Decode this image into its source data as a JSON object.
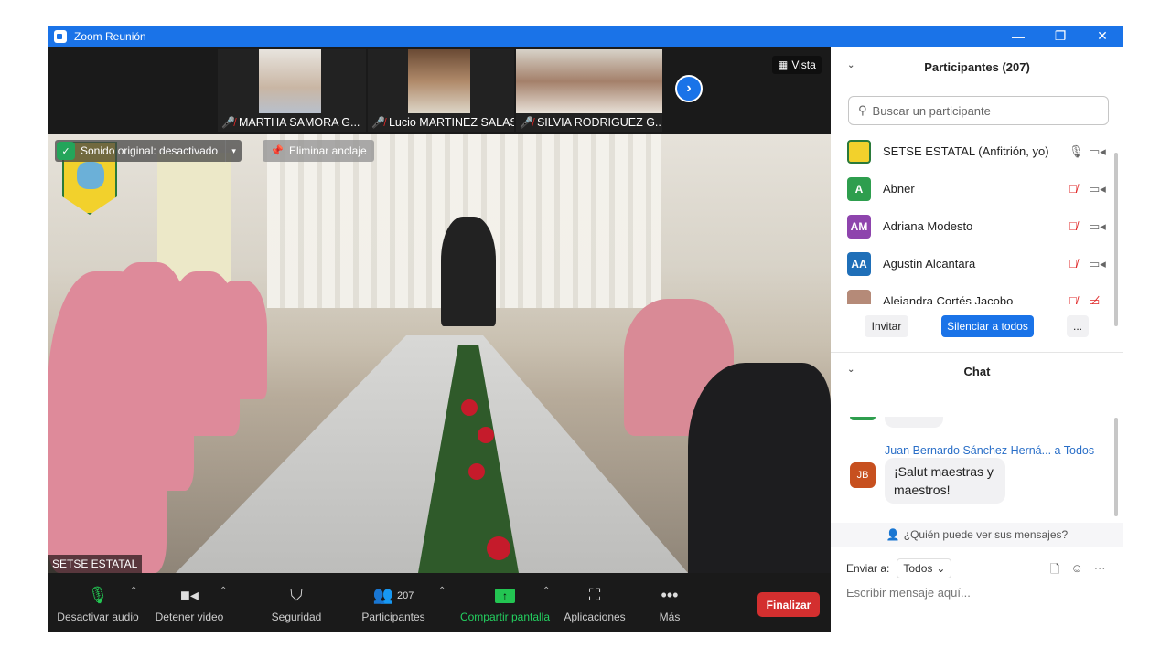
{
  "window": {
    "title": "Zoom Reunión",
    "controls": [
      "—",
      "❐",
      "✕"
    ]
  },
  "thumbnails": [
    {
      "name": "MARTHA SAMORA G...",
      "muted": true
    },
    {
      "name": "Lucio MARTINEZ SALAS",
      "muted": true
    },
    {
      "name": "SILVIA RODRIGUEZ G...",
      "muted": true
    }
  ],
  "view_label": "Vista",
  "main_video": {
    "audio_banner": "Sonido original: desactivado",
    "unpin_label": "Eliminar anclaje",
    "speaker_name": "SETSE ESTATAL"
  },
  "toolbar": {
    "mute_label": "Desactivar audio",
    "video_label": "Detener video",
    "security_label": "Seguridad",
    "participants_label": "Participantes",
    "participants_count": "207",
    "share_label": "Compartir pantalla",
    "apps_label": "Aplicaciones",
    "more_label": "Más",
    "end_label": "Finalizar"
  },
  "participants_panel": {
    "title": "Participantes (207)",
    "search_placeholder": "Buscar un participante",
    "rows": [
      {
        "name": "SETSE ESTATAL (Anfitrión, yo)",
        "initials": "",
        "color": "#f2d12c"
      },
      {
        "name": "Abner",
        "initials": "A",
        "color": "#2e9e4e"
      },
      {
        "name": "Adriana Modesto",
        "initials": "AM",
        "color": "#8e44ad"
      },
      {
        "name": "Agustin Alcantara",
        "initials": "AA",
        "color": "#1f6fb8"
      },
      {
        "name": "Alejandra Cortés Jacobo",
        "initials": "",
        "color": "#b58a78"
      }
    ],
    "invite_label": "Invitar",
    "mute_all_label": "Silenciar a todos",
    "more_label": "..."
  },
  "chat_panel": {
    "title": "Chat",
    "sender": "Juan Bernardo Sánchez Herná...",
    "to": "a Todos",
    "initials": "JB",
    "message": "¡Salut maestras y maestros!",
    "who_sees": "¿Quién puede ver sus mensajes?",
    "send_to_label": "Enviar a:",
    "recipient": "Todos",
    "input_placeholder": "Escribir mensaje aquí..."
  }
}
